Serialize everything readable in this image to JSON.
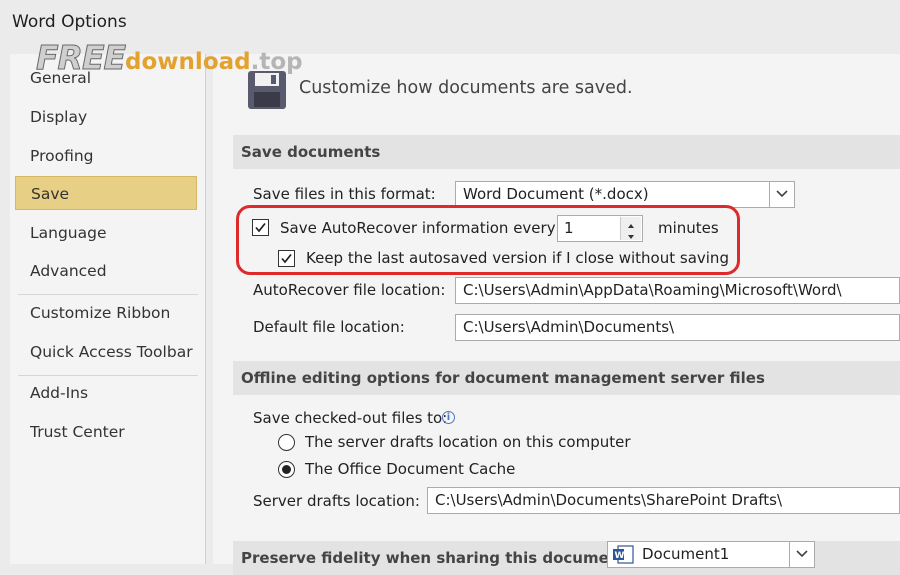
{
  "window": {
    "title": "Word Options"
  },
  "watermark": {
    "free": "FREE",
    "download": "download",
    "top": ".top"
  },
  "sidebar": {
    "items": [
      {
        "label": "General"
      },
      {
        "label": "Display"
      },
      {
        "label": "Proofing"
      },
      {
        "label": "Save",
        "active": true
      },
      {
        "label": "Language"
      },
      {
        "label": "Advanced"
      },
      {
        "label": "Customize Ribbon"
      },
      {
        "label": "Quick Access Toolbar"
      },
      {
        "label": "Add-Ins"
      },
      {
        "label": "Trust Center"
      }
    ]
  },
  "header": {
    "icon": "floppy-disk-icon",
    "text": "Customize how documents are saved."
  },
  "save_documents": {
    "heading": "Save documents",
    "format_label": "Save files in this format:",
    "format_value": "Word Document (*.docx)",
    "autorecover_label": "Save AutoRecover information every",
    "autorecover_checked": true,
    "autorecover_minutes": "1",
    "minutes_label": "minutes",
    "keep_last_label": "Keep the last autosaved version if I close without saving",
    "keep_last_checked": true,
    "autorecover_location_label": "AutoRecover file location:",
    "autorecover_location_value": "C:\\Users\\Admin\\AppData\\Roaming\\Microsoft\\Word\\",
    "default_location_label": "Default file location:",
    "default_location_value": "C:\\Users\\Admin\\Documents\\"
  },
  "offline": {
    "heading": "Offline editing options for document management server files",
    "checked_out_label": "Save checked-out files to:",
    "info_icon": "i",
    "radio_server": "The server drafts location on this computer",
    "radio_cache": "The Office Document Cache",
    "selected": "The Office Document Cache",
    "drafts_label": "Server drafts location:",
    "drafts_value": "C:\\Users\\Admin\\Documents\\SharePoint Drafts\\"
  },
  "fidelity": {
    "heading": "Preserve fidelity when sharing this document:",
    "document_value": "Document1"
  },
  "colors": {
    "active_nav": "#e8cf86",
    "highlight": "#de2a2a"
  }
}
